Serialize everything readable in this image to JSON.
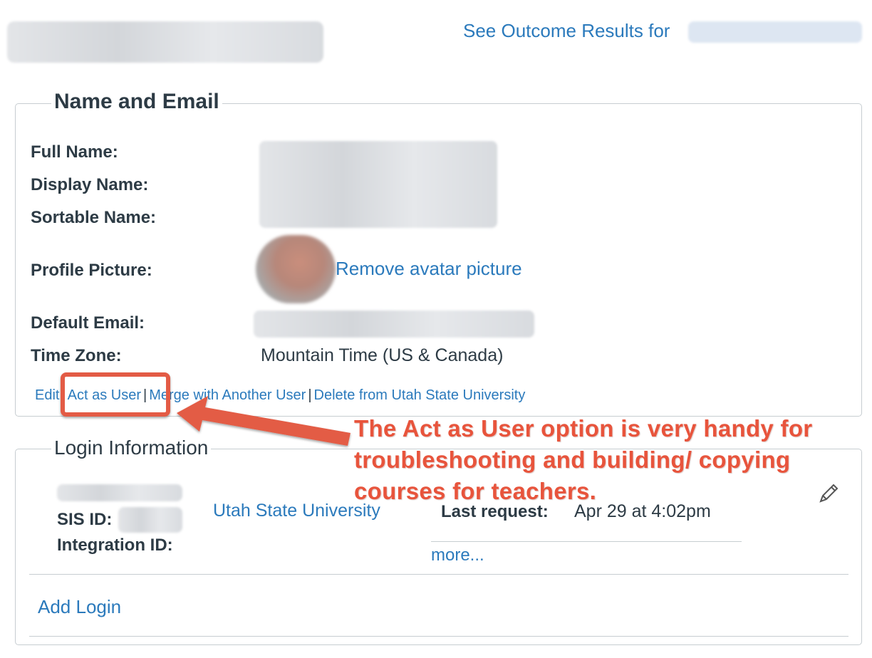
{
  "header": {
    "outcome_link": "See Outcome Results for"
  },
  "name_email": {
    "legend": "Name and Email",
    "full_name_label": "Full Name:",
    "display_name_label": "Display Name:",
    "sortable_name_label": "Sortable Name:",
    "profile_picture_label": "Profile Picture:",
    "remove_avatar": "Remove avatar picture",
    "default_email_label": "Default Email:",
    "time_zone_label": "Time Zone:",
    "time_zone_value": "Mountain Time (US & Canada)"
  },
  "actions": {
    "edit": "Edit",
    "act_as_user": "Act as User",
    "merge": "Merge with Another User",
    "delete": "Delete from Utah State University",
    "separator": "|"
  },
  "login_info": {
    "legend": "Login Information",
    "sis_id_label": "SIS ID:",
    "integration_id_label": "Integration ID:",
    "institution": "Utah State University",
    "last_request_label": "Last request:",
    "last_request_value": "Apr 29 at 4:02pm",
    "more_link": "more...",
    "add_login": "Add Login"
  },
  "annotation": {
    "text": "The Act as User option is very handy for troubleshooting and building/ copying courses for teachers.",
    "accent_color": "#e35b45"
  },
  "colors": {
    "link": "#2b7abc",
    "text": "#2d3b45",
    "border": "#c7cdd1"
  }
}
